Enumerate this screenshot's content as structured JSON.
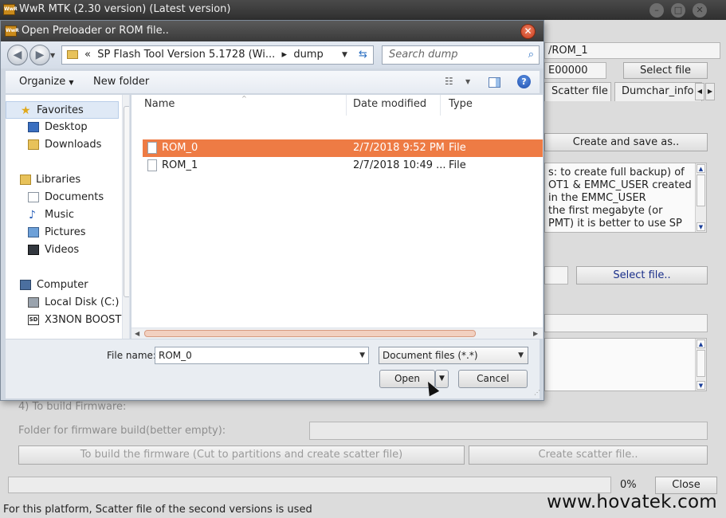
{
  "main_window": {
    "title": "WwR MTK (2.30 version) (Latest version)",
    "logo_text": "WwR",
    "controls": [
      "–",
      "□",
      "✕"
    ],
    "rom_path_fragment": "/ROM_1",
    "hex_field": "E00000",
    "select_file_label": "Select file",
    "tabs": [
      "Scatter file",
      "Dumchar_info"
    ],
    "create_save_label": "Create and save as..",
    "info_lines": [
      "s: to create full backup) of",
      "OT1 & EMMC_USER created",
      "in the EMMC_USER",
      "the first megabyte (or",
      "PMT) it is better to use SP"
    ],
    "select_file2_label": "Select file..",
    "section4_title": "4) To build Firmware:",
    "folder_label": "Folder for firmware build(better empty):",
    "build_button": "To build the firmware (Cut to partitions and create scatter file)",
    "create_scatter_button": "Create scatter file..",
    "progress_percent": "0%",
    "progress_value": 0,
    "close_label": "Close",
    "status_text": "For this platform, Scatter file of the second versions is used",
    "watermark": "www.hovatek.com"
  },
  "dialog": {
    "title": "Open Preloader or ROM file..",
    "logo_text": "WwR",
    "address": {
      "prefix": "«",
      "crumb1": "SP Flash Tool Version 5.1728 (Wi...",
      "sep": "▸",
      "crumb2": "dump"
    },
    "search_placeholder": "Search dump",
    "toolbar": {
      "organize": "Organize",
      "new_folder": "New folder"
    },
    "nav": {
      "favorites": "Favorites",
      "desktop": "Desktop",
      "downloads": "Downloads",
      "libraries": "Libraries",
      "documents": "Documents",
      "music": "Music",
      "pictures": "Pictures",
      "videos": "Videos",
      "computer": "Computer",
      "local_disk": "Local Disk (C:)",
      "x3non": "X3NON BOOST"
    },
    "columns": {
      "name": "Name",
      "date": "Date modified",
      "type": "Type"
    },
    "files": [
      {
        "name": "ROM_0",
        "date": "2/7/2018 9:52 PM",
        "type": "File",
        "selected": true
      },
      {
        "name": "ROM_1",
        "date": "2/7/2018 10:49 ...",
        "type": "File",
        "selected": false
      }
    ],
    "file_name_label": "File name:",
    "file_name_value": "ROM_0",
    "file_type": "Document files (*.*)",
    "open_label": "Open",
    "cancel_label": "Cancel"
  },
  "colors": {
    "selection": "#ee7b44",
    "titlebar": "#3a3a3a",
    "accent_blue": "#1a2f8a"
  }
}
